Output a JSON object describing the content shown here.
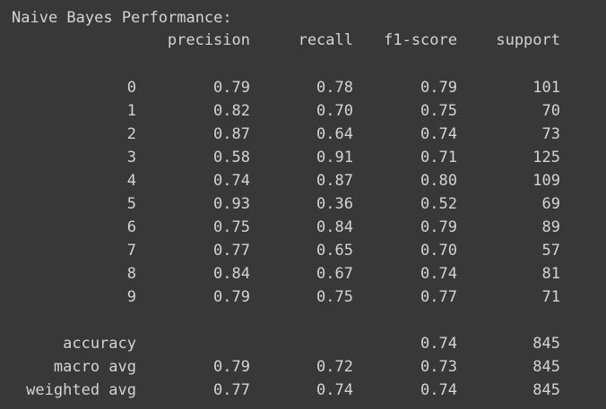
{
  "output": {
    "heading": "Naive Bayes Performance:",
    "columns": [
      "precision",
      "recall",
      "f1-score",
      "support"
    ],
    "class_rows": [
      {
        "label": "0",
        "precision": "0.79",
        "recall": "0.78",
        "f1": "0.79",
        "support": "101"
      },
      {
        "label": "1",
        "precision": "0.82",
        "recall": "0.70",
        "f1": "0.75",
        "support": "70"
      },
      {
        "label": "2",
        "precision": "0.87",
        "recall": "0.64",
        "f1": "0.74",
        "support": "73"
      },
      {
        "label": "3",
        "precision": "0.58",
        "recall": "0.91",
        "f1": "0.71",
        "support": "125"
      },
      {
        "label": "4",
        "precision": "0.74",
        "recall": "0.87",
        "f1": "0.80",
        "support": "109"
      },
      {
        "label": "5",
        "precision": "0.93",
        "recall": "0.36",
        "f1": "0.52",
        "support": "69"
      },
      {
        "label": "6",
        "precision": "0.75",
        "recall": "0.84",
        "f1": "0.79",
        "support": "89"
      },
      {
        "label": "7",
        "precision": "0.77",
        "recall": "0.65",
        "f1": "0.70",
        "support": "57"
      },
      {
        "label": "8",
        "precision": "0.84",
        "recall": "0.67",
        "f1": "0.74",
        "support": "81"
      },
      {
        "label": "9",
        "precision": "0.79",
        "recall": "0.75",
        "f1": "0.77",
        "support": "71"
      }
    ],
    "summary_rows": [
      {
        "label": "accuracy",
        "precision": "",
        "recall": "",
        "f1": "0.74",
        "support": "845"
      },
      {
        "label": "macro avg",
        "precision": "0.79",
        "recall": "0.72",
        "f1": "0.73",
        "support": "845"
      },
      {
        "label": "weighted avg",
        "precision": "0.77",
        "recall": "0.74",
        "f1": "0.74",
        "support": "845"
      }
    ]
  },
  "colors": {
    "background": "#383838",
    "text": "#d4d4d4"
  }
}
